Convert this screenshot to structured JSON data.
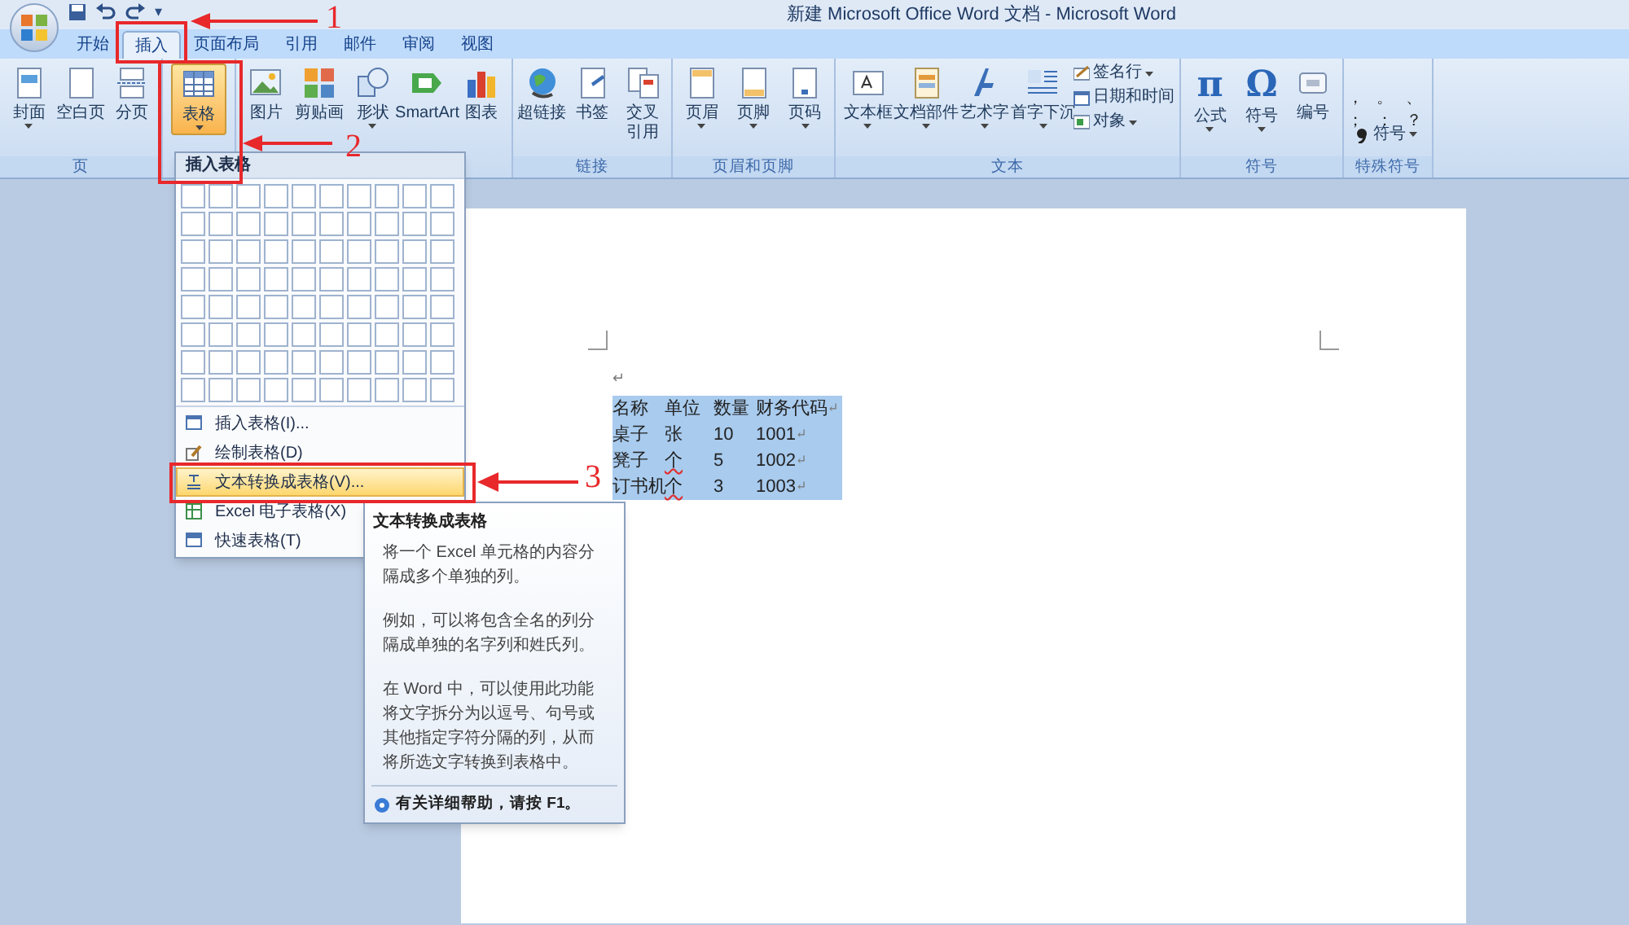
{
  "window": {
    "title": "新建 Microsoft Office Word 文档 - Microsoft Word",
    "quick_access_more": "▾"
  },
  "tabs": [
    {
      "label": "开始",
      "selected": false
    },
    {
      "label": "插入",
      "selected": true
    },
    {
      "label": "页面布局",
      "selected": false
    },
    {
      "label": "引用",
      "selected": false
    },
    {
      "label": "邮件",
      "selected": false
    },
    {
      "label": "审阅",
      "selected": false
    },
    {
      "label": "视图",
      "selected": false
    }
  ],
  "ribbon": {
    "groups": [
      {
        "buttons": [
          {
            "label": "封面",
            "dropdown": true,
            "pressed": false
          },
          {
            "label": "空白页",
            "dropdown": false,
            "pressed": false
          },
          {
            "label": "分页",
            "dropdown": false,
            "pressed": false
          }
        ],
        "label": "页"
      },
      {
        "buttons": [
          {
            "label": "表格",
            "dropdown": true,
            "pressed": true
          }
        ]
      },
      {
        "buttons": [
          {
            "label": "图片",
            "dropdown": false,
            "pressed": false
          },
          {
            "label": "剪贴画",
            "dropdown": false,
            "pressed": false
          },
          {
            "label": "形状",
            "dropdown": true,
            "pressed": false
          },
          {
            "label": "SmartArt",
            "dropdown": false,
            "pressed": false
          },
          {
            "label": "图表",
            "dropdown": false,
            "pressed": false
          }
        ]
      },
      {
        "buttons": [
          {
            "label": "超链接",
            "dropdown": false,
            "pressed": false
          },
          {
            "label": "书签",
            "dropdown": false,
            "pressed": false
          },
          {
            "lines": [
              "交叉",
              "引用"
            ],
            "dropdown": false,
            "pressed": false
          }
        ],
        "label": "链接"
      },
      {
        "buttons": [
          {
            "label": "页眉",
            "dropdown": true,
            "pressed": false
          },
          {
            "label": "页脚",
            "dropdown": true,
            "pressed": false
          },
          {
            "label": "页码",
            "dropdown": true,
            "pressed": false
          }
        ],
        "label": "页眉和页脚"
      },
      {
        "buttons": [
          {
            "label": "文本框",
            "dropdown": true,
            "pressed": false
          },
          {
            "label": "文档部件",
            "dropdown": true,
            "pressed": false
          },
          {
            "label": "艺术字",
            "dropdown": true,
            "pressed": false
          },
          {
            "label": "首字下沉",
            "dropdown": true,
            "pressed": false
          }
        ],
        "small_buttons": [
          {
            "label": "签名行",
            "dropdown": true
          },
          {
            "label": "日期和时间",
            "dropdown": false
          },
          {
            "label": "对象",
            "dropdown": true
          }
        ],
        "label": "文本"
      },
      {
        "buttons": [
          {
            "label": "公式",
            "glyph": "π",
            "dropdown": true,
            "pressed": false
          },
          {
            "label": "符号",
            "glyph": "Ω",
            "dropdown": true,
            "pressed": false
          },
          {
            "label": "编号",
            "dropdown": false,
            "pressed": false
          }
        ],
        "label": "符号"
      },
      {
        "symbols": [
          "，",
          "。",
          "、",
          "；",
          "：",
          "？"
        ],
        "small_buttons": [
          {
            "label": "符号",
            "dropdown": true
          }
        ],
        "label": "特殊符号"
      }
    ]
  },
  "table_menu": {
    "header": "插入表格",
    "items": [
      {
        "label": "插入表格(I)...",
        "selected": false
      },
      {
        "label": "绘制表格(D)",
        "selected": false
      },
      {
        "label": "文本转换成表格(V)...",
        "selected": true
      },
      {
        "label": "Excel 电子表格(X)",
        "selected": false
      },
      {
        "label": "快速表格(T)",
        "selected": false
      }
    ]
  },
  "tooltip": {
    "title": "文本转换成表格",
    "paragraphs": [
      "将一个 Excel 单元格的内容分隔成多个单独的列。",
      "例如，可以将包含全名的列分隔成单独的名字列和姓氏列。",
      "在 Word 中，可以使用此功能将文字拆分为以逗号、句号或其他指定字符分隔的列，从而将所选文字转换到表格中。"
    ],
    "help": "有关详细帮助，请按 F1。"
  },
  "document": {
    "first_line": "↵",
    "selected": true,
    "rows": [
      {
        "cells": [
          {
            "text": "名称",
            "spelling_error": false
          },
          {
            "text": "单位",
            "spelling_error": false
          },
          {
            "text": "数量",
            "spelling_error": false
          },
          {
            "text": "财务代码",
            "spelling_error": false
          }
        ],
        "mark": "↵"
      },
      {
        "cells": [
          {
            "text": "桌子",
            "spelling_error": false
          },
          {
            "text": "张",
            "spelling_error": false
          },
          {
            "text": "10",
            "spelling_error": false
          },
          {
            "text": "1001",
            "spelling_error": false
          }
        ],
        "mark": "↵"
      },
      {
        "cells": [
          {
            "text": "凳子",
            "spelling_error": false
          },
          {
            "text": "个",
            "spelling_error": true
          },
          {
            "text": "5",
            "spelling_error": false
          },
          {
            "text": "1002",
            "spelling_error": false
          }
        ],
        "mark": "↵"
      },
      {
        "cells": [
          {
            "text": "订书机",
            "spelling_error": false
          },
          {
            "text": "个",
            "spelling_error": true
          },
          {
            "text": "3",
            "spelling_error": false
          },
          {
            "text": "1003",
            "spelling_error": false
          }
        ],
        "mark": "↵"
      }
    ]
  },
  "annotations": [
    {
      "number": "1"
    },
    {
      "number": "2"
    },
    {
      "number": "3"
    }
  ]
}
